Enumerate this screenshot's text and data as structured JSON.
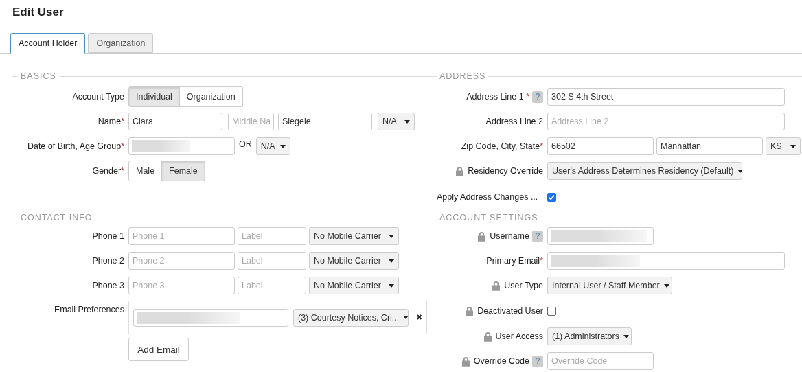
{
  "title": "Edit User",
  "tabs": [
    {
      "label": "Account Holder",
      "selected": true
    },
    {
      "label": "Organization",
      "selected": false
    }
  ],
  "basics": {
    "heading": "BASICS",
    "account_type": {
      "label": "Account Type",
      "options": [
        {
          "label": "Individual",
          "selected": true
        },
        {
          "label": "Organization",
          "selected": false
        }
      ]
    },
    "name": {
      "label": "Name",
      "required_mark": "*",
      "first": {
        "value": "Clara"
      },
      "middle": {
        "placeholder": "Middle Na"
      },
      "last": {
        "value": "Siegele"
      },
      "suffix": "N/A"
    },
    "birth": {
      "label": "Date of Birth, Age Group",
      "required_mark": "*",
      "redacted": true,
      "or": "OR",
      "age_group": "N/A"
    },
    "gender": {
      "label": "Gender",
      "required_mark": "*",
      "options": [
        {
          "label": "Male",
          "selected": false
        },
        {
          "label": "Female",
          "selected": true
        }
      ]
    }
  },
  "contact": {
    "heading": "CONTACT INFO",
    "phones": [
      {
        "label": "Phone 1",
        "placeholder": "Phone 1",
        "label_placeholder": "Label",
        "carrier": "No Mobile Carrier"
      },
      {
        "label": "Phone 2",
        "placeholder": "Phone 2",
        "label_placeholder": "Label",
        "carrier": "No Mobile Carrier"
      },
      {
        "label": "Phone 3",
        "placeholder": "Phone 3",
        "label_placeholder": "Label",
        "carrier": "No Mobile Carrier"
      }
    ],
    "email_preferences": {
      "label": "Email Preferences",
      "emails": [
        {
          "redacted": true,
          "preference": "(3) Courtesy Notices, Cri...",
          "remove": "✖"
        }
      ],
      "add_button": "Add Email"
    }
  },
  "address": {
    "heading": "ADDRESS",
    "line1": {
      "label": "Address Line 1",
      "required_mark": " *",
      "help": "?",
      "value": "302 S 4th Street"
    },
    "line2": {
      "label": "Address Line 2",
      "placeholder": "Address Line 2"
    },
    "location": {
      "label": "Zip Code, City, State",
      "required_mark": "*",
      "zip": "66502",
      "city": "Manhattan",
      "state": "KS"
    },
    "residency": {
      "label": "Residency Override",
      "locked": true,
      "value": "User's Address Determines Residency (Default)"
    },
    "apply": {
      "label": "Apply Address Changes ...",
      "checked": true
    }
  },
  "account_settings": {
    "heading": "ACCOUNT SETTINGS",
    "username": {
      "label": "Username",
      "locked": true,
      "help": "?",
      "redacted": true
    },
    "primary_email": {
      "label": "Primary Email",
      "required_mark": "*",
      "redacted": true
    },
    "user_type": {
      "label": "User Type",
      "locked": true,
      "value": "Internal User / Staff Member"
    },
    "deactivated": {
      "label": "Deactivated User",
      "locked": true,
      "checked": false
    },
    "user_access": {
      "label": "User Access",
      "locked": true,
      "value": "(1) Administrators"
    },
    "override_code": {
      "label": "Override Code",
      "locked": true,
      "help": "?",
      "placeholder": "Override Code"
    }
  }
}
